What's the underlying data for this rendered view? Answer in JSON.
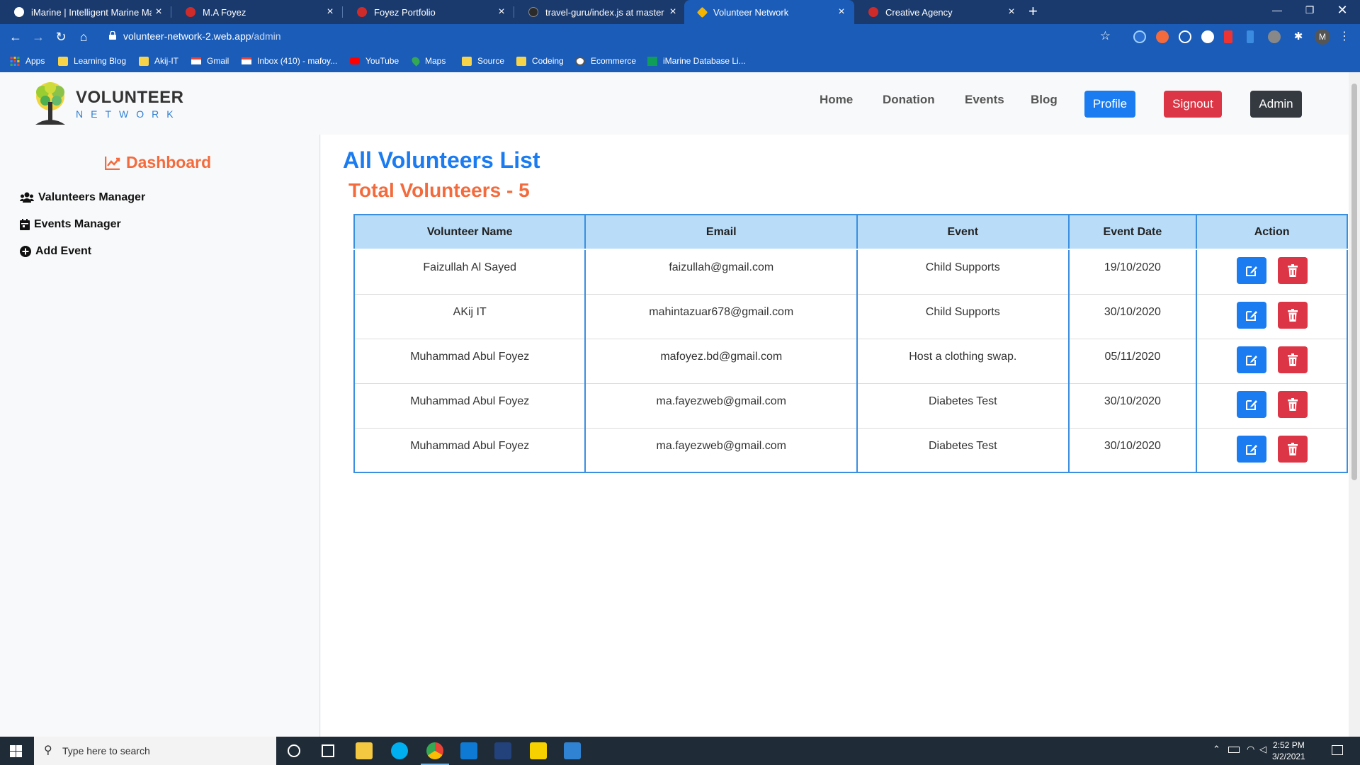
{
  "browser": {
    "tabs": [
      {
        "title": "iMarine | Intelligent Marine Mana",
        "icon": "imarine-favicon",
        "active": false
      },
      {
        "title": "M.A Foyez",
        "icon": "react-favicon",
        "active": false
      },
      {
        "title": "Foyez Portfolio",
        "icon": "react-favicon",
        "active": false
      },
      {
        "title": "travel-guru/index.js at master · m",
        "icon": "github-favicon",
        "active": false
      },
      {
        "title": "Volunteer Network",
        "icon": "firebase-favicon",
        "active": true
      },
      {
        "title": "Creative Agency",
        "icon": "react-favicon",
        "active": false
      }
    ],
    "new_tab": "+",
    "address": {
      "host": "volunteer-network-2.web.app",
      "path": "/admin"
    },
    "bookmarks": [
      {
        "label": "Apps",
        "icon": "apps-grid-icon"
      },
      {
        "label": "Learning Blog",
        "icon": "folder-icon"
      },
      {
        "label": "Akij-IT",
        "icon": "folder-icon"
      },
      {
        "label": "Gmail",
        "icon": "gmail-icon"
      },
      {
        "label": "Inbox (410) - mafoy...",
        "icon": "gmail-icon"
      },
      {
        "label": "YouTube",
        "icon": "youtube-icon"
      },
      {
        "label": "Maps",
        "icon": "maps-icon"
      },
      {
        "label": "Source",
        "icon": "folder-icon"
      },
      {
        "label": "Codeing",
        "icon": "folder-icon"
      },
      {
        "label": "Ecommerce",
        "icon": "globe-icon"
      },
      {
        "label": "iMarine Database Li...",
        "icon": "sheets-icon"
      }
    ],
    "profile_initial": "M"
  },
  "site": {
    "logo_title": "VOLUNTEER",
    "logo_subtitle": "NETWORK",
    "nav": [
      "Home",
      "Donation",
      "Events",
      "Blog"
    ],
    "buttons": {
      "profile": "Profile",
      "signout": "Signout",
      "admin": "Admin"
    },
    "colors": {
      "primary": "#1a7cf0",
      "danger": "#dc3545",
      "dark": "#343a40",
      "accent": "#f36b3d"
    }
  },
  "sidebar": {
    "title": "Dashboard",
    "items": [
      {
        "label": "Valunteers Manager",
        "icon": "users-icon"
      },
      {
        "label": "Events Manager",
        "icon": "calendar-icon"
      },
      {
        "label": "Add Event",
        "icon": "plus-circle-icon"
      }
    ]
  },
  "main": {
    "title": "All Volunteers List",
    "total": "Total Volunteers - 5",
    "columns": [
      "Volunteer Name",
      "Email",
      "Event",
      "Event Date",
      "Action"
    ],
    "rows": [
      {
        "name": "Faizullah Al Sayed",
        "email": "faizullah@gmail.com",
        "event": "Child Supports",
        "date": "19/10/2020"
      },
      {
        "name": "AKij IT",
        "email": "mahintazuar678@gmail.com",
        "event": "Child Supports",
        "date": "30/10/2020"
      },
      {
        "name": "Muhammad Abul Foyez",
        "email": "mafoyez.bd@gmail.com",
        "event": "Host a clothing swap.",
        "date": "05/11/2020"
      },
      {
        "name": "Muhammad Abul Foyez",
        "email": "ma.fayezweb@gmail.com",
        "event": "Diabetes Test",
        "date": "30/10/2020"
      },
      {
        "name": "Muhammad Abul Foyez",
        "email": "ma.fayezweb@gmail.com",
        "event": "Diabetes Test",
        "date": "30/10/2020"
      }
    ]
  },
  "taskbar": {
    "search_placeholder": "Type here to search",
    "time": "2:52 PM",
    "date": "3/2/2021"
  }
}
